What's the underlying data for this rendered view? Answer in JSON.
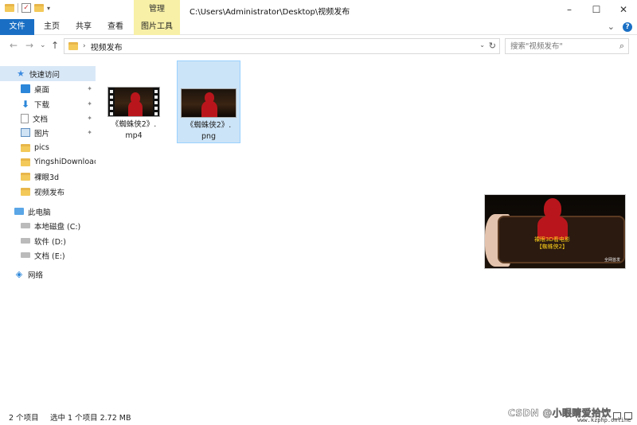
{
  "titlebar": {
    "context_tab": "管理",
    "path_title": "C:\\Users\\Administrator\\Desktop\\视频发布",
    "minimize_glyph": "–",
    "maximize_glyph": "☐",
    "close_glyph": "✕"
  },
  "ribbon": {
    "tabs": [
      "文件",
      "主页",
      "共享",
      "查看",
      "图片工具"
    ],
    "collapse_glyph": "⌄",
    "help_glyph": "?"
  },
  "nav": {
    "back_glyph": "←",
    "forward_glyph": "→",
    "recent_glyph": "⌄",
    "up_glyph": "↑",
    "address_separator": "›",
    "address_text": "视频发布",
    "refresh_glyph": "↻",
    "search_placeholder": "搜索\"视频发布\"",
    "search_glyph": "⌕"
  },
  "sidebar": {
    "items": [
      {
        "label": "快速访问",
        "icon": "star-icon",
        "pinned": false,
        "selected": true
      },
      {
        "label": "桌面",
        "icon": "desktop-icon",
        "pinned": true
      },
      {
        "label": "下载",
        "icon": "download-icon",
        "pinned": true
      },
      {
        "label": "文档",
        "icon": "document-icon",
        "pinned": true
      },
      {
        "label": "图片",
        "icon": "pictures-icon",
        "pinned": true
      },
      {
        "label": "pics",
        "icon": "folder-icon",
        "pinned": false
      },
      {
        "label": "YingshiDownload",
        "icon": "folder-icon",
        "pinned": false
      },
      {
        "label": "裸眼3d",
        "icon": "folder-icon",
        "pinned": false
      },
      {
        "label": "视频发布",
        "icon": "folder-icon",
        "pinned": false
      },
      {
        "label": "此电脑",
        "icon": "computer-icon",
        "pinned": false
      },
      {
        "label": "本地磁盘 (C:)",
        "icon": "drive-icon",
        "pinned": false
      },
      {
        "label": "软件 (D:)",
        "icon": "drive-icon",
        "pinned": false
      },
      {
        "label": "文档 (E:)",
        "icon": "drive-icon",
        "pinned": false
      },
      {
        "label": "网络",
        "icon": "network-icon",
        "pinned": false
      }
    ],
    "pin_glyph": "📌"
  },
  "files": [
    {
      "name_line1": "《蜘蛛侠2》.",
      "name_line2": "mp4",
      "type": "video",
      "selected": false
    },
    {
      "name_line1": "《蜘蛛侠2》.",
      "name_line2": "png",
      "type": "image",
      "selected": true
    }
  ],
  "preview": {
    "caption_line1": "裸眼3D看电影",
    "caption_line2": "【蜘蛛侠2】",
    "caption_corner": "全网首发"
  },
  "status": {
    "item_count": "2 个项目",
    "selection": "选中 1 个项目  2.72 MB"
  },
  "watermark": {
    "text": "CSDN @小眼睛爱拾饮",
    "sub": "www.kzphp.online"
  },
  "colors": {
    "accent": "#1a6fc4",
    "context_tab": "#f7f0a6",
    "selection": "#cce4f7"
  }
}
